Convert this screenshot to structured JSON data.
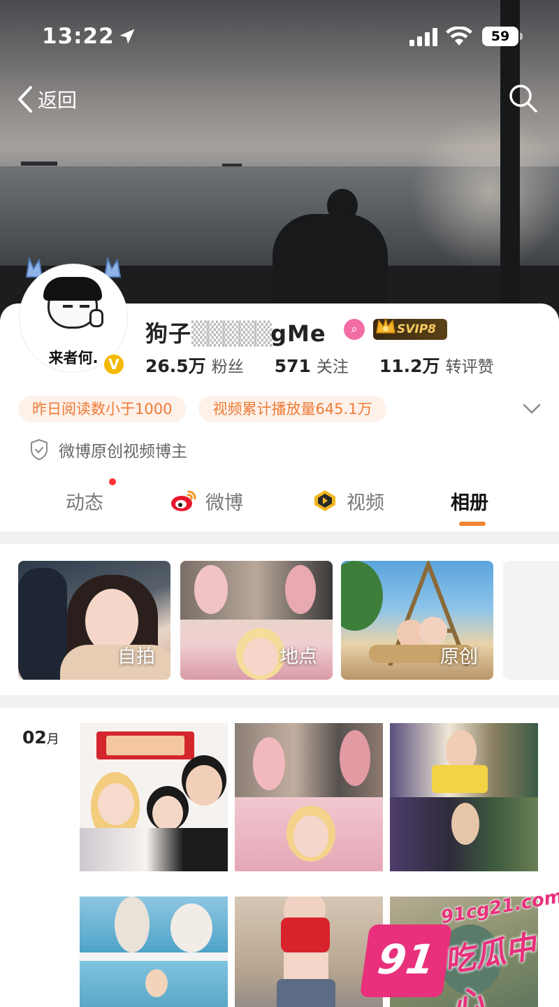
{
  "status_bar": {
    "time": "13:22",
    "battery": "59"
  },
  "nav": {
    "back_label": "返回"
  },
  "profile": {
    "avatar_caption": "来者何.",
    "name": "狗子",
    "name_partial": "gMe",
    "vip_label": "SVIP8",
    "stats": [
      {
        "value": "26.5万",
        "label": "粉丝"
      },
      {
        "value": "571",
        "label": "关注"
      },
      {
        "value": "11.2万",
        "label": "转评赞"
      }
    ],
    "tags": [
      "昨日阅读数小于1000",
      "视频累计播放量645.1万"
    ],
    "badge": "微博原创视频博主"
  },
  "tabs": [
    {
      "label": "动态",
      "icon": "none"
    },
    {
      "label": "微博",
      "icon": "weibo-icon"
    },
    {
      "label": "视频",
      "icon": "video-icon"
    },
    {
      "label": "相册",
      "icon": "none"
    }
  ],
  "active_tab": "相册",
  "albums": [
    "自拍",
    "地点",
    "原创"
  ],
  "month": {
    "number": "02",
    "unit": "月"
  },
  "watermark": {
    "number": "91",
    "url": "91cg21.com",
    "title": "吃瓜中心"
  },
  "colors": {
    "accent": "#f08434",
    "tag_text": "#ef7a35",
    "tag_bg": "#fdf1ea",
    "watermark": "#e8307c"
  }
}
